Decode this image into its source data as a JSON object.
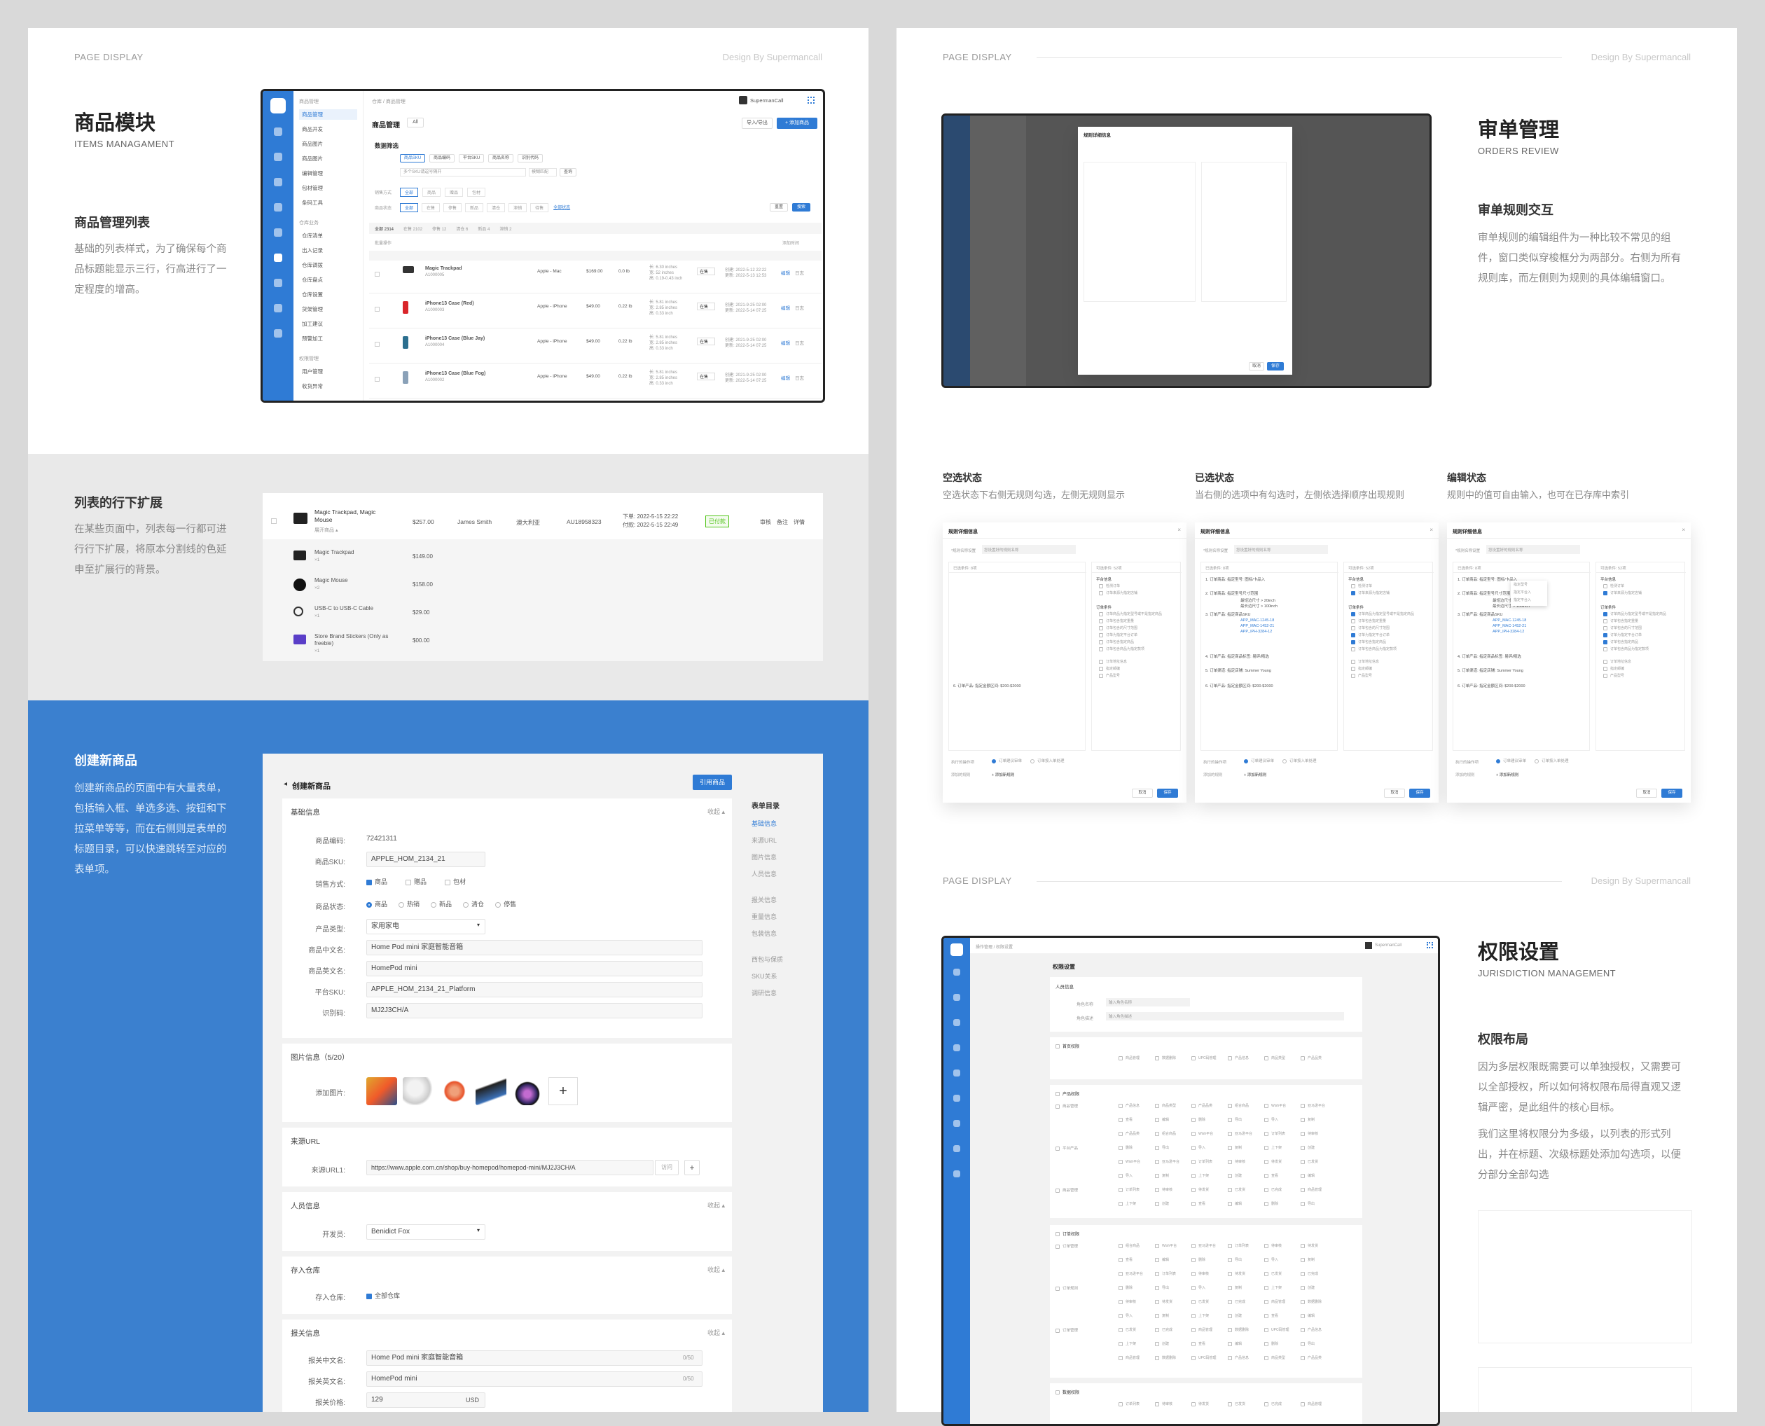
{
  "page": {
    "page_display": "PAGE DISPLAY",
    "design_by": "Design By Supermancall"
  },
  "items": {
    "title": "商品模块",
    "subtitle": "ITEMS MANAGAMENT",
    "list_heading": "商品管理列表",
    "list_desc": "基础的列表样式，为了确保每个商品标题能显示三行，行高进行了一定程度的增高。",
    "expand_heading": "列表的行下扩展",
    "expand_desc": "在某些页面中，列表每一行都可进行行下扩展，将原本分割线的色延申至扩展行的背景。",
    "create_heading": "创建新商品",
    "create_desc": "创建新商品的页面中有大量表单，包括输入框、单选多选、按钮和下拉菜单等等，而在右侧则是表单的标题目录，可以快速跳转至对应的表单项。"
  },
  "list_mock": {
    "user": "SupermanCall",
    "breadcrumb": "仓库 / 商品管理",
    "menu_group1": "商品管理",
    "menu": [
      "商品管理",
      "商品开发",
      "商品图片",
      "商品图片",
      "编辑管理",
      "包材管理",
      "条码工具"
    ],
    "menu_group2": "仓库业务",
    "menu2": [
      "仓库清单",
      "出入记录",
      "仓库调拨",
      "仓库盘点",
      "仓库设置",
      "货架管理",
      "加工建议",
      "预警加工"
    ],
    "menu_group3": "权限管理",
    "menu3": [
      "用户管理",
      "收货异常"
    ],
    "page_title": "商品管理",
    "dropdown": "All",
    "btn_import": "导入/导出",
    "btn_add": "+ 添加商品",
    "filter_title": "数据筛选",
    "filter_tabs": [
      "商品SKU",
      "商品编码",
      "平台SKU",
      "商品名称",
      "识别代码"
    ],
    "search_placeholder": "多个SKU请逗号隔开",
    "fuzzy": "模糊匹配",
    "search_btn": "查询",
    "sale_label": "销售方式",
    "sale_opts": [
      "全部",
      "商品",
      "赠品",
      "包材"
    ],
    "status_label": "商品状态",
    "status_opts": [
      "全部",
      "在售",
      "停售",
      "新品",
      "清仓",
      "滞销",
      "待售",
      "全部状态"
    ],
    "reset": "重置",
    "query": "搜索",
    "count_tabs": [
      "全部 2314",
      "在售 2102",
      "停售 12",
      "清仓 6",
      "新品 4",
      "滞销 2"
    ],
    "batch": "批量操作",
    "sort": "添加时间",
    "rows": [
      {
        "name": "Magic Trackpad",
        "code": "A1000005",
        "cat": "Apple - Mac",
        "price": "$169.00",
        "weight": "0.0 lb",
        "size1": "长: 6.30 inches",
        "size2": "宽: 52 inches",
        "size3": "高: 0.19-0.43 inch",
        "status": "在售",
        "t1": "创建: 2022-5-12  22:22",
        "t2": "更新: 2022-5-13  12:53"
      },
      {
        "name": "iPhone13 Case (Red)",
        "code": "A1000003",
        "cat": "Apple - iPhone",
        "price": "$49.00",
        "weight": "0.22 lb",
        "size1": "长: 5.81 inches",
        "size2": "宽: 2.85 inches",
        "size3": "高: 0.33 inch",
        "status": "在售",
        "t1": "创建: 2021-9-25  02:00",
        "t2": "更新: 2022-5-14  07:25"
      },
      {
        "name": "iPhone13 Case (Blue Jay)",
        "code": "A1000004",
        "cat": "Apple - iPhone",
        "price": "$49.00",
        "weight": "0.22 lb",
        "size1": "长: 5.81 inches",
        "size2": "宽: 2.85 inches",
        "size3": "高: 0.33 inch",
        "status": "在售",
        "t1": "创建: 2021-9-25  02:00",
        "t2": "更新: 2022-5-14  07:25"
      },
      {
        "name": "iPhone13 Case (Blue Fog)",
        "code": "A1000002",
        "cat": "Apple - iPhone",
        "price": "$49.00",
        "weight": "0.22 lb",
        "size1": "长: 5.81 inches",
        "size2": "宽: 2.85 inches",
        "size3": "高: 0.33 inch",
        "status": "在售",
        "t1": "创建: 2021-9-25  02:00",
        "t2": "更新: 2022-5-14  07:25"
      }
    ],
    "row_edit": "编辑",
    "row_log": "日志"
  },
  "expand_mock": {
    "main": {
      "name": "Magic Trackpad, Magic Mouse",
      "sub": "展开商品 ▴",
      "total": "$257.00",
      "buyer": "James Smith",
      "country": "澳大利亚",
      "order": "AU18958323",
      "t1": "下单: 2022-5-15  22:22",
      "t2": "付款: 2022-5-15  22:49",
      "badge": "已付款",
      "actions": [
        "审核",
        "备注",
        "详情"
      ]
    },
    "subs": [
      {
        "name": "Magic Trackpad",
        "qty": "×1",
        "price": "$149.00"
      },
      {
        "name": "Magic Mouse",
        "qty": "×2",
        "price": "$158.00"
      },
      {
        "name": "USB-C to USB-C Cable",
        "qty": "×1",
        "price": "$29.00"
      },
      {
        "name": "Store Brand Stickers (Only as freebie)",
        "qty": "×1",
        "price": "$00.00"
      }
    ]
  },
  "create_mock": {
    "title": "创建新商品",
    "apply_btn": "引用商品",
    "basic": "基础信息",
    "collapse": "收起 ▴",
    "labels": [
      "商品编码:",
      "商品SKU:",
      "销售方式:",
      "商品状态:",
      "产品类型:",
      "商品中文名:",
      "商品英文名:",
      "平台SKU:",
      "识别码:"
    ],
    "code": "72421311",
    "sku": "APPLE_HOM_2134_21",
    "sale_opts": [
      "商品",
      "赠品",
      "包材"
    ],
    "status_opts": [
      "商品",
      "热销",
      "新品",
      "清仓",
      "停售"
    ],
    "type": "家用家电",
    "cn_name": "Home Pod mini 家庭智能音箱",
    "en_name": "HomePod mini",
    "platform_sku": "APPLE_HOM_2134_21_Platform",
    "ident": "MJ2J3CH/A",
    "images_title": "图片信息（5/20）",
    "add_image": "添加图片:",
    "source_title": "来源URL",
    "source_label": "来源URL1:",
    "source_url": "https://www.apple.com.cn/shop/buy-homepod/homepod-mini/MJ2J3CH/A",
    "visit": "访问",
    "people_title": "人员信息",
    "dev_label": "开发员:",
    "dev": "Benidict Fox",
    "warehouse_title": "存入仓库",
    "wh_label": "存入仓库:",
    "wh_opt": "全部仓库",
    "customs_title": "报关信息",
    "customs_cn_label": "报关中文名:",
    "customs_cn": "Home Pod mini 家庭智能音箱",
    "customs_en_label": "报关英文名:",
    "customs_en": "HomePod mini",
    "price_label": "报关价格:",
    "price": "129",
    "currency": "USD",
    "count": "0/50",
    "toc_title": "表单目录",
    "toc": [
      "基础信息",
      "来源URL",
      "图片信息",
      "人员信息",
      "报关信息",
      "重量信息",
      "包装信息",
      "西包与保质",
      "SKU关系",
      "调研信息"
    ]
  },
  "orders": {
    "title": "审单管理",
    "subtitle": "ORDERS REVIEW",
    "heading": "审单规则交互",
    "desc": "审单规则的编辑组件为一种比较不常见的组件，窗口类似穿梭框分为两部分。右侧为所有规则库，而左侧则为规则的具体编辑窗口。",
    "states": [
      {
        "title": "空选状态",
        "desc": "空选状态下右侧无规则勾选，左侧无规则显示"
      },
      {
        "title": "已选状态",
        "desc": "当右侧的选项中有勾选时，左侧依选择顺序出现规则"
      },
      {
        "title": "编辑状态",
        "desc": "规则中的值可自由输入，也可在已存库中索引"
      }
    ],
    "dialog_title": "规则详细信息",
    "rule_name_label": "*规则名称设置",
    "rule_name_ph": "您设置好的规则名称",
    "selected": "已选条件: 8项",
    "available": "可选条件: 52项",
    "rules": [
      "1. 订单商品: 指定型号: 图标/卡品入",
      "2. 订单商品: 指定型号尺寸范围",
      "最短边尺寸 > 20inch",
      "最长边尺寸 > 100inch",
      "3. 订单产品: 指定商品SKU",
      "APP_MAC-1245-18",
      "APP_MAC-1452-21",
      "APP_IPH-3284-12",
      "4. 订单产品: 指定商品标签: 易碎/精选",
      "5. 订单渠道: 指定店铺: Summer Young",
      "6. 订单产品: 指定金额区间: $200-$2000"
    ],
    "right_groups": [
      "平台信息",
      "订单条件"
    ],
    "right_items": [
      "检测订单",
      "订单来源为指定店铺",
      "订单商品为指定型号或不是指定商品",
      "订单包含指定重量",
      "订单包含的尺寸范围",
      "订单为指定平台订单",
      "订单包含指定商品",
      "订单包含商品为指定款项",
      "订单地址信息",
      "指定邮编",
      "产品型号"
    ],
    "exec_label": "执行的操作项",
    "exec_opts": [
      "订单建议审单",
      "订单按入单处理"
    ],
    "other_label": "添加的规则",
    "add_rule": "+ 添加新规则",
    "cancel": "取消",
    "save": "保存",
    "edit_popover": [
      "指定型号",
      "指定平台入",
      "指定平台入"
    ]
  },
  "perm": {
    "title": "权限设置",
    "subtitle": "JURISDICTION MANAGEMENT",
    "heading": "权限布局",
    "desc1": "因为多层权限既需要可以单独授权，又需要可以全部授权，所以如何将权限布局得直观又逻辑严密，是此组件的核心目标。",
    "desc2": "我们这里将权限分为多级，以列表的形式列出，并在标题、次级标题处添加勾选项，以便分部分全部勾选",
    "mock_title": "权限设置",
    "breadcrumb": "操作管理 / 权限设置",
    "user": "SupermanCall",
    "person": "人员信息",
    "name_label": "角色名称",
    "name_ph": "输入角色名称",
    "desc_label": "角色描述",
    "desc_ph": "输入角色描述",
    "sections": [
      "首页权限",
      "产品权限",
      "订单权限",
      "数据权限"
    ],
    "groups": [
      [
        "商品管理",
        "平台产品"
      ],
      [
        "订单管理",
        "订单规则",
        "物流设置"
      ]
    ],
    "ops": [
      "创建",
      "查看",
      "编辑",
      "删除",
      "导出",
      "导入",
      "复制",
      "上下架"
    ],
    "tags": [
      "商品管理",
      "数据删除",
      "UPC码管理",
      "产品信息",
      "商品类型",
      "产品品类",
      "组合商品",
      "Wish平台",
      "亚马逊平台",
      "订单列表",
      "待审核",
      "待发货",
      "已发货",
      "已完成"
    ]
  },
  "colors": {
    "brand": "#2f7bd5",
    "success": "#52c41a"
  }
}
